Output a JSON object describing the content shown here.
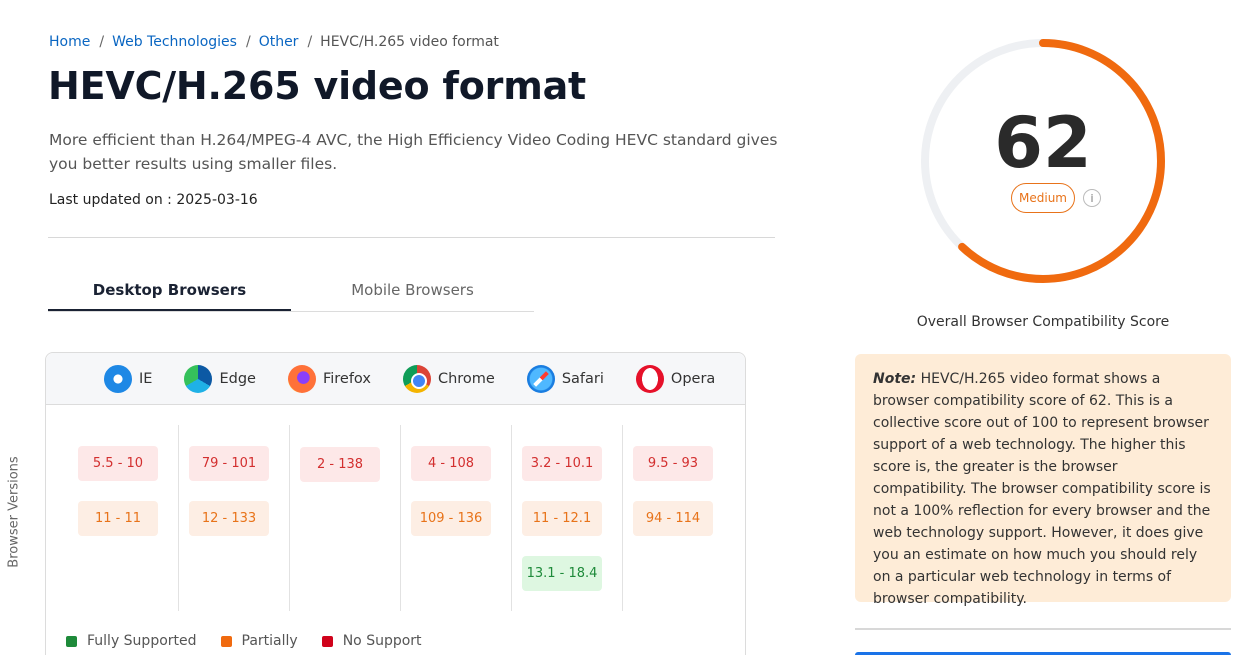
{
  "breadcrumb": {
    "items": [
      {
        "label": "Home"
      },
      {
        "label": "Web Technologies"
      },
      {
        "label": "Other"
      }
    ],
    "separator": "/",
    "current": "HEVC/H.265 video format"
  },
  "title": "HEVC/H.265 video format",
  "description": "More efficient than H.264/MPEG-4 AVC, the High Efficiency Video Coding HEVC standard gives you better results using smaller files.",
  "last_updated": "Last updated on : 2025-03-16",
  "tabs": [
    {
      "label": "Desktop Browsers",
      "active": true
    },
    {
      "label": "Mobile Browsers",
      "active": false
    }
  ],
  "browsers": [
    {
      "name": "IE",
      "icon": "ie-icon",
      "versions": [
        {
          "range": "5.5 - 10",
          "status": "no"
        },
        {
          "range": "11 - 11",
          "status": "partial"
        }
      ]
    },
    {
      "name": "Edge",
      "icon": "edge-icon",
      "versions": [
        {
          "range": "79 - 101",
          "status": "no"
        },
        {
          "range": "12 - 133",
          "status": "partial"
        }
      ]
    },
    {
      "name": "Firefox",
      "icon": "firefox-icon",
      "versions": [
        {
          "range": "2 - 138",
          "status": "no"
        }
      ]
    },
    {
      "name": "Chrome",
      "icon": "chrome-icon",
      "versions": [
        {
          "range": "4 - 108",
          "status": "no"
        },
        {
          "range": "109 - 136",
          "status": "partial"
        }
      ]
    },
    {
      "name": "Safari",
      "icon": "safari-icon",
      "versions": [
        {
          "range": "3.2 - 10.1",
          "status": "no"
        },
        {
          "range": "11 - 12.1",
          "status": "partial"
        },
        {
          "range": "13.1 - 18.4",
          "status": "full"
        }
      ]
    },
    {
      "name": "Opera",
      "icon": "opera-icon",
      "versions": [
        {
          "range": "9.5 - 93",
          "status": "no"
        },
        {
          "range": "94 - 114",
          "status": "partial"
        }
      ]
    }
  ],
  "y_axis_label": "Browser Versions",
  "legend": [
    {
      "label": "Fully Supported",
      "color": "#1e8a3a"
    },
    {
      "label": "Partially",
      "color": "#f06a0f"
    },
    {
      "label": "No Support",
      "color": "#d0021b"
    }
  ],
  "score": {
    "value": 62,
    "max": 100,
    "badge": "Medium",
    "caption": "Overall Browser Compatibility Score",
    "ring_color": "#f06a0f",
    "track_color": "#eef0f3"
  },
  "note": {
    "label": "Note:",
    "text": " HEVC/H.265 video format shows a browser compatibility score of 62. This is a collective score out of 100 to represent browser support of a web technology. The higher this score is, the greater is the browser compatibility. The browser compatibility score is not a 100% reflection for every browser and the web technology support. However, it does give you an estimate on how much you should rely on a particular web technology in terms of browser compatibility."
  }
}
